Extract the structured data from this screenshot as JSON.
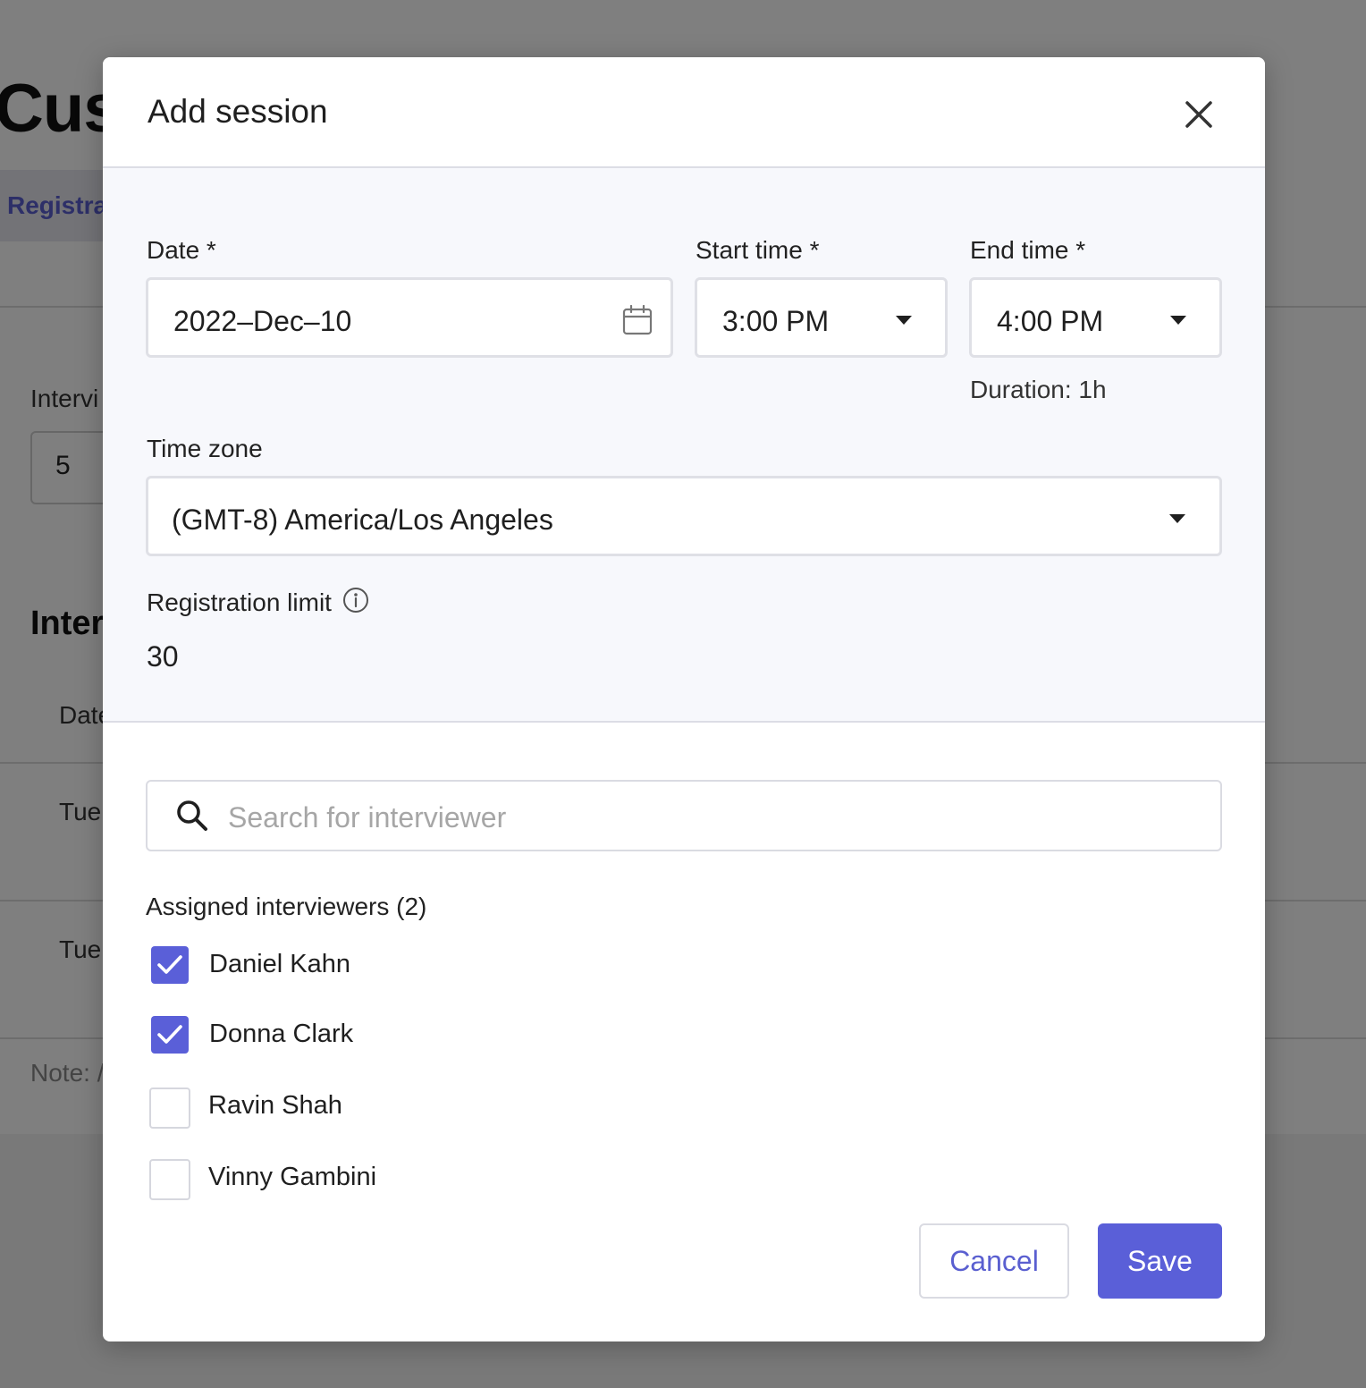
{
  "background": {
    "page_title": "Cust",
    "tab_label": "Registra",
    "field_label": "Intervi",
    "field_value": "5",
    "section_heading": "Inter",
    "table_header": "Date",
    "rows": [
      "Tue",
      "Tue"
    ],
    "note": "Note: /"
  },
  "modal": {
    "title": "Add session",
    "close_icon": "close-icon",
    "date": {
      "label": "Date *",
      "value": "2022–Dec–10",
      "icon": "calendar-icon"
    },
    "start_time": {
      "label": "Start time *",
      "value": "3:00 PM"
    },
    "end_time": {
      "label": "End time *",
      "value": "4:00 PM",
      "helper": "Duration: 1h"
    },
    "time_zone": {
      "label": "Time zone",
      "value": "(GMT-8) America/Los Angeles"
    },
    "registration_limit": {
      "label": "Registration limit",
      "value": "30",
      "icon": "info-icon"
    },
    "search": {
      "placeholder": "Search for interviewer",
      "icon": "search-icon"
    },
    "assigned_label": "Assigned interviewers (2)",
    "interviewers": [
      {
        "name": "Daniel Kahn",
        "checked": true
      },
      {
        "name": "Donna Clark",
        "checked": true
      },
      {
        "name": "Ravin Shah",
        "checked": false
      },
      {
        "name": "Vinny Gambini",
        "checked": false
      }
    ],
    "buttons": {
      "cancel": "Cancel",
      "save": "Save"
    }
  },
  "colors": {
    "accent": "#5a5fd8",
    "overlay": "rgba(0,0,0,0.5)",
    "section_bg": "#f7f8fc"
  }
}
